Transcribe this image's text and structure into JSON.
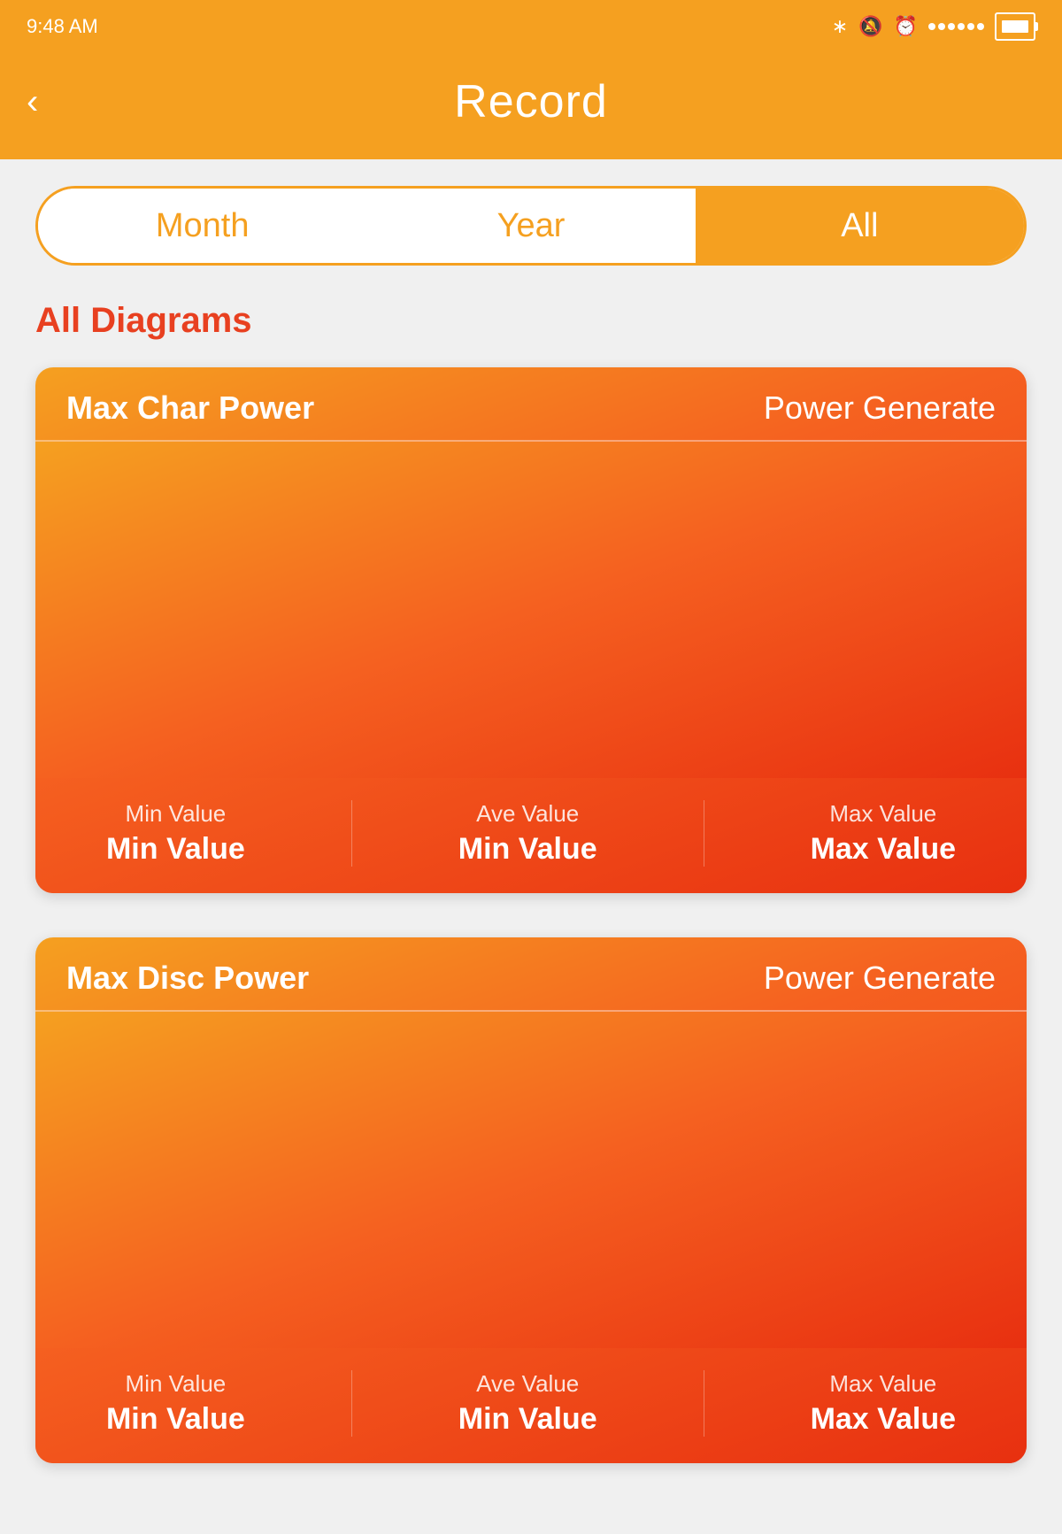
{
  "statusBar": {
    "time": "9:48 AM"
  },
  "header": {
    "backLabel": "‹",
    "title": "Record"
  },
  "tabs": [
    {
      "id": "month",
      "label": "Month",
      "active": false
    },
    {
      "id": "year",
      "label": "Year",
      "active": false
    },
    {
      "id": "all",
      "label": "All",
      "active": true
    }
  ],
  "sectionTitle": "All Diagrams",
  "cards": [
    {
      "id": "char-power",
      "titleLeft": "Max Char Power",
      "titleRight": "Power Generate",
      "stats": [
        {
          "labelTop": "Min Value",
          "labelBottom": "Min Value"
        },
        {
          "labelTop": "Ave Value",
          "labelBottom": "Min Value"
        },
        {
          "labelTop": "Max Value",
          "labelBottom": "Max Value"
        }
      ]
    },
    {
      "id": "disc-power",
      "titleLeft": "Max Disc Power",
      "titleRight": "Power Generate",
      "stats": [
        {
          "labelTop": "Min Value",
          "labelBottom": "Min Value"
        },
        {
          "labelTop": "Ave Value",
          "labelBottom": "Min Value"
        },
        {
          "labelTop": "Max Value",
          "labelBottom": "Max Value"
        }
      ]
    }
  ]
}
